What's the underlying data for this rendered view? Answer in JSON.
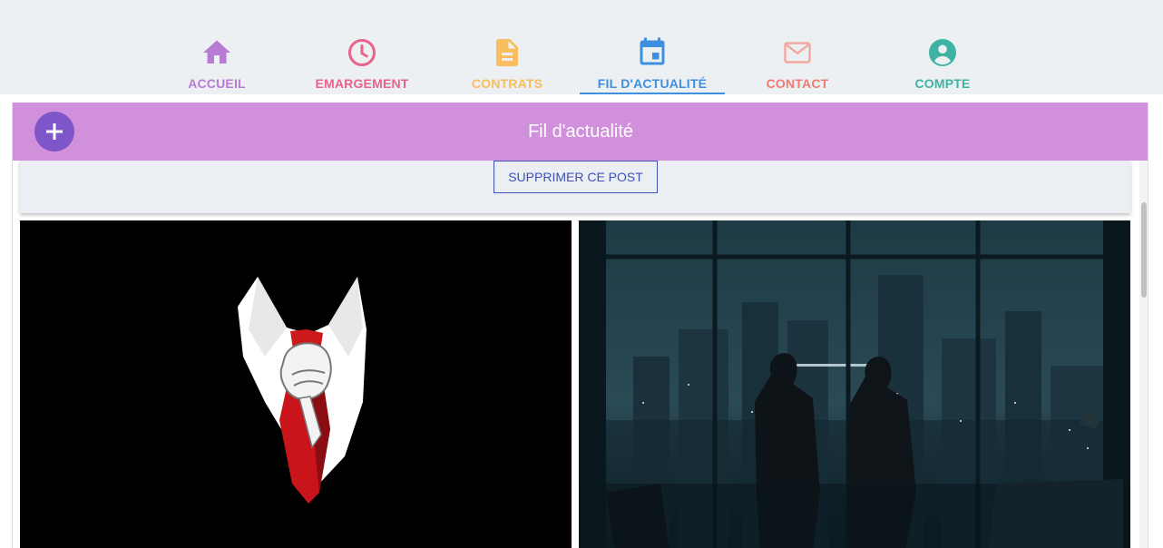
{
  "nav": {
    "items": [
      {
        "label": "ACCUEIL",
        "icon": "home-icon",
        "color": "#b77bd3",
        "active": false
      },
      {
        "label": "EMARGEMENT",
        "icon": "clock-icon",
        "color": "#e9628c",
        "active": false
      },
      {
        "label": "CONTRATS",
        "icon": "document-icon",
        "color": "#f8bd5c",
        "active": false
      },
      {
        "label": "FIL D'ACTUALITÉ",
        "icon": "calendar-icon",
        "color": "#3d8fe0",
        "active": true
      },
      {
        "label": "CONTACT",
        "icon": "mail-icon",
        "color": "#ef7b72",
        "active": false
      },
      {
        "label": "COMPTE",
        "icon": "account-icon",
        "color": "#3fb3a3",
        "active": false
      }
    ]
  },
  "feed": {
    "title": "Fil d'actualité",
    "header_color": "#d190dc",
    "add_button_color": "#7f56c9"
  },
  "post": {
    "delete_label": "SUPPRIMER CE POST"
  },
  "photos": [
    {
      "subject": "white-collar-red-tie-hand"
    },
    {
      "subject": "couple-silhouette-city-window-night"
    }
  ]
}
